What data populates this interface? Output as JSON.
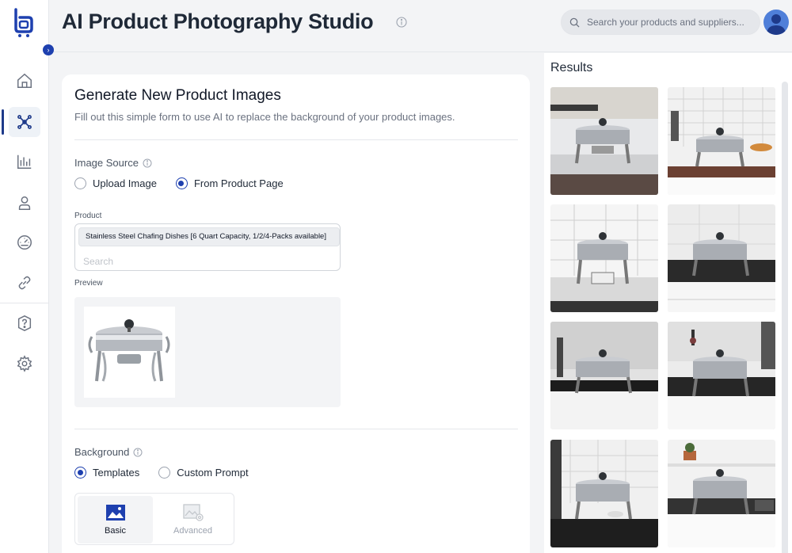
{
  "header": {
    "title": "AI Product Photography Studio",
    "search_placeholder": "Search your products and suppliers..."
  },
  "sidebar": {
    "items": [
      {
        "name": "home-icon",
        "active": false
      },
      {
        "name": "network-icon",
        "active": true
      },
      {
        "name": "analytics-icon",
        "active": false
      },
      {
        "name": "user-icon",
        "active": false
      },
      {
        "name": "dashboard-gauge-icon",
        "active": false
      },
      {
        "name": "link-icon",
        "active": false
      },
      {
        "name": "help-icon",
        "active": false
      },
      {
        "name": "settings-icon",
        "active": false
      }
    ]
  },
  "form": {
    "title": "Generate New Product Images",
    "subtitle": "Fill out this simple form to use AI to replace the background of your product images.",
    "image_source": {
      "label": "Image Source",
      "options": [
        "Upload Image",
        "From Product Page"
      ],
      "selected": "From Product Page"
    },
    "product": {
      "label": "Product",
      "selected": "Stainless Steel Chafing Dishes [6 Quart Capacity, 1/2/4-Packs available]",
      "search_placeholder": "Search"
    },
    "preview_label": "Preview",
    "background": {
      "label": "Background",
      "options": [
        "Templates",
        "Custom Prompt"
      ],
      "selected": "Templates",
      "templates": [
        "Basic",
        "Advanced"
      ],
      "selected_template": "Basic"
    }
  },
  "results": {
    "title": "Results",
    "count": 8
  },
  "colors": {
    "accent": "#1e40af",
    "avatar": "#4f7fd9"
  }
}
